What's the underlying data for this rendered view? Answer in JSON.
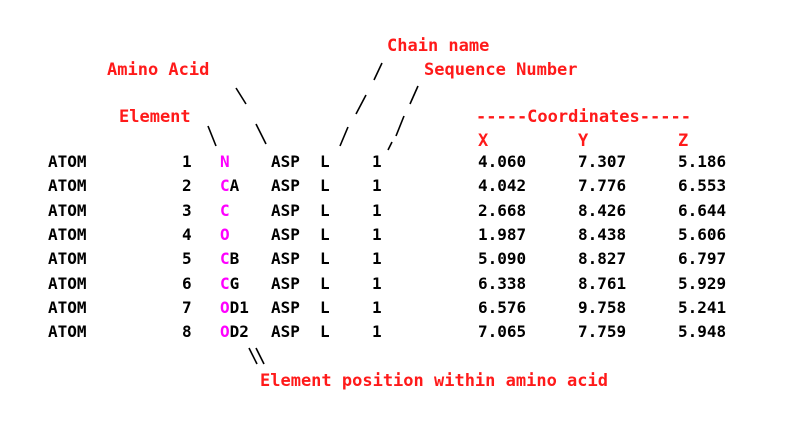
{
  "colors": {
    "annotation": "#ff1a1a",
    "element_symbol": "#ff00ff",
    "text": "#000000"
  },
  "annotations": {
    "chain_name": "Chain name",
    "amino_acid": "Amino Acid",
    "sequence_number": "Sequence Number",
    "element": "Element",
    "coordinates": "-----Coordinates-----",
    "x_header": "X",
    "y_header": "Y",
    "z_header": "Z",
    "element_position": "Element position within amino acid"
  },
  "rows": [
    {
      "record": "ATOM",
      "serial": "1",
      "element": "N",
      "position": "",
      "residue": "ASP",
      "chain": "L",
      "seq": "1",
      "x": "4.060",
      "y": "7.307",
      "z": "5.186"
    },
    {
      "record": "ATOM",
      "serial": "2",
      "element": "C",
      "position": "A",
      "residue": "ASP",
      "chain": "L",
      "seq": "1",
      "x": "4.042",
      "y": "7.776",
      "z": "6.553"
    },
    {
      "record": "ATOM",
      "serial": "3",
      "element": "C",
      "position": "",
      "residue": "ASP",
      "chain": "L",
      "seq": "1",
      "x": "2.668",
      "y": "8.426",
      "z": "6.644"
    },
    {
      "record": "ATOM",
      "serial": "4",
      "element": "O",
      "position": "",
      "residue": "ASP",
      "chain": "L",
      "seq": "1",
      "x": "1.987",
      "y": "8.438",
      "z": "5.606"
    },
    {
      "record": "ATOM",
      "serial": "5",
      "element": "C",
      "position": "B",
      "residue": "ASP",
      "chain": "L",
      "seq": "1",
      "x": "5.090",
      "y": "8.827",
      "z": "6.797"
    },
    {
      "record": "ATOM",
      "serial": "6",
      "element": "C",
      "position": "G",
      "residue": "ASP",
      "chain": "L",
      "seq": "1",
      "x": "6.338",
      "y": "8.761",
      "z": "5.929"
    },
    {
      "record": "ATOM",
      "serial": "7",
      "element": "O",
      "position": "D1",
      "residue": "ASP",
      "chain": "L",
      "seq": "1",
      "x": "6.576",
      "y": "9.758",
      "z": "5.241"
    },
    {
      "record": "ATOM",
      "serial": "8",
      "element": "O",
      "position": "D2",
      "residue": "ASP",
      "chain": "L",
      "seq": "1",
      "x": "7.065",
      "y": "7.759",
      "z": "5.948"
    }
  ]
}
